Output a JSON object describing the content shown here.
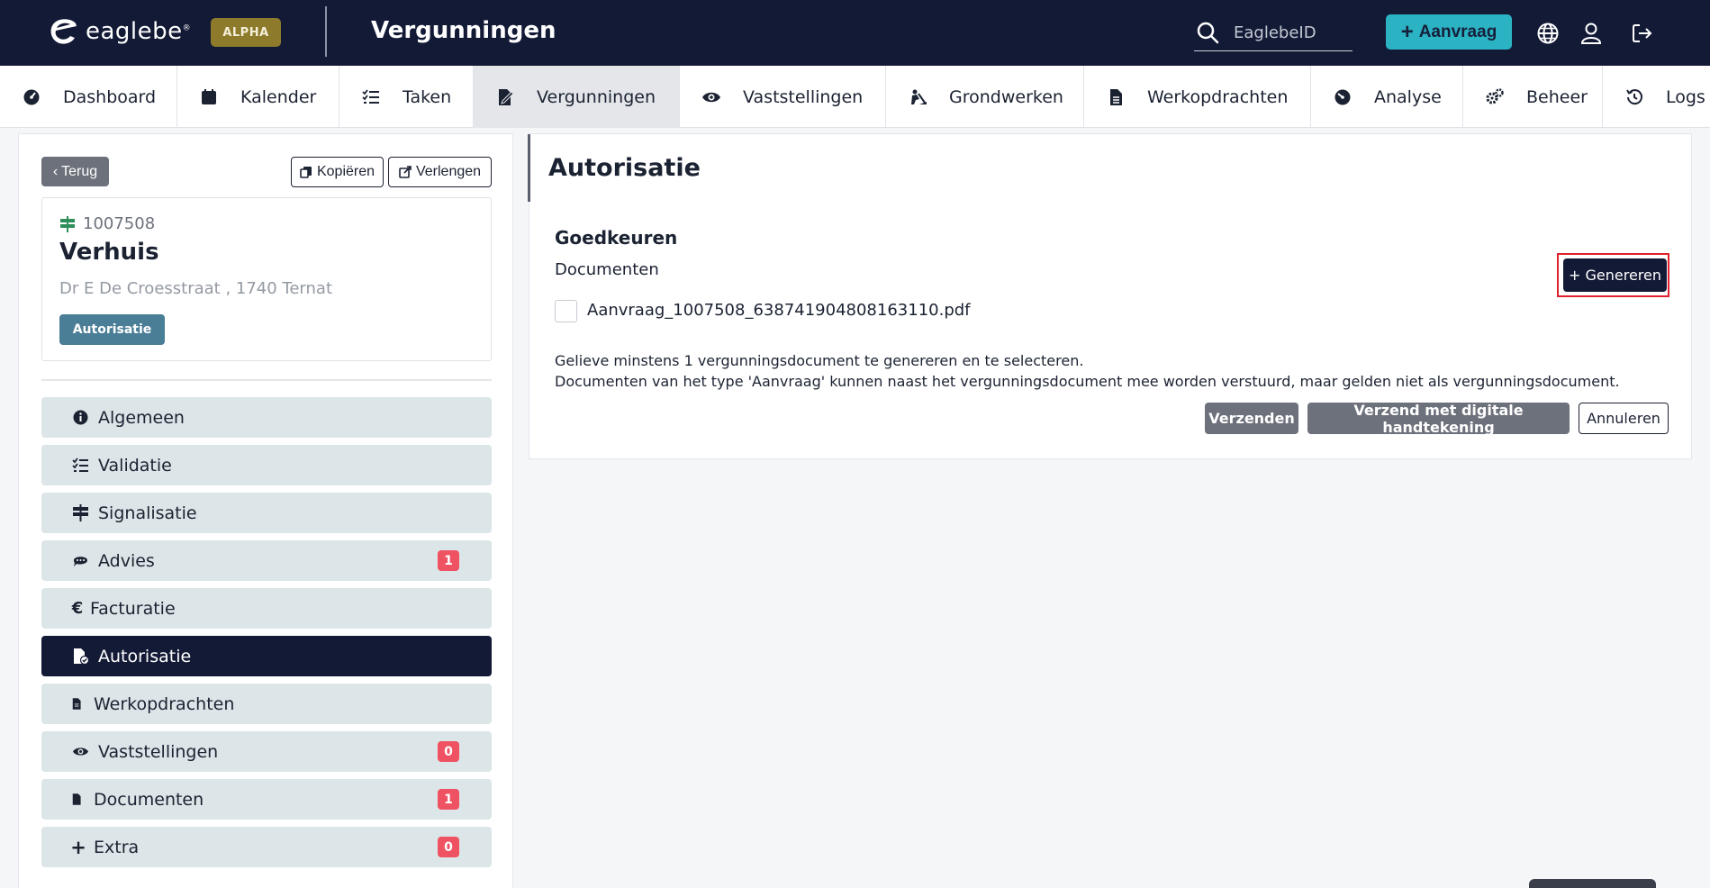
{
  "header": {
    "logo_text": "eaglebe",
    "logo_reg": "®",
    "env_badge": "ALPHA",
    "page_title": "Vergunningen",
    "search_placeholder": "EaglebeID",
    "new_request_label": "Aanvraag",
    "icons": [
      "globe-icon",
      "user-icon",
      "logout-icon"
    ],
    "colors": {
      "background": "#131a36",
      "alpha": "#8d7a2b",
      "accent": "#2bb3c4"
    }
  },
  "nav": {
    "items": [
      {
        "label": "Dashboard",
        "icon": "dashboard-icon"
      },
      {
        "label": "Kalender",
        "icon": "calendar-icon"
      },
      {
        "label": "Taken",
        "icon": "tasks-icon"
      },
      {
        "label": "Vergunningen",
        "icon": "permit-icon",
        "active": true
      },
      {
        "label": "Vaststellingen",
        "icon": "eye-icon"
      },
      {
        "label": "Grondwerken",
        "icon": "digging-icon"
      },
      {
        "label": "Werkopdrachten",
        "icon": "document-icon"
      },
      {
        "label": "Analyse",
        "icon": "gauge-icon"
      },
      {
        "label": "Beheer",
        "icon": "cogs-icon"
      },
      {
        "label": "Logs",
        "icon": "history-icon"
      }
    ]
  },
  "left": {
    "back_label": "Terug",
    "copy_label": "Kopiëren",
    "extend_label": "Verlengen",
    "card": {
      "id": "1007508",
      "title": "Verhuis",
      "address": "Dr E De Croesstraat , 1740 Ternat",
      "status": "Autorisatie"
    },
    "menu": [
      {
        "label": "Algemeen",
        "icon": "info-icon"
      },
      {
        "label": "Validatie",
        "icon": "checklist-icon"
      },
      {
        "label": "Signalisatie",
        "icon": "signpost-icon"
      },
      {
        "label": "Advies",
        "icon": "comments-icon",
        "count": "1"
      },
      {
        "label": "Facturatie",
        "icon": "euro-icon"
      },
      {
        "label": "Autorisatie",
        "icon": "file-check-icon",
        "active": true
      },
      {
        "label": "Werkopdrachten",
        "icon": "file-icon"
      },
      {
        "label": "Vaststellingen",
        "icon": "eye-icon",
        "count": "0"
      },
      {
        "label": "Documenten",
        "icon": "file-icon",
        "count": "1"
      },
      {
        "label": "Extra",
        "icon": "plus-icon",
        "count": "0"
      }
    ]
  },
  "main": {
    "title": "Autorisatie",
    "section_title": "Goedkeuren",
    "documents_label": "Documenten",
    "generate_label": "+ Genereren",
    "file_name": "Aanvraag_1007508_638741904808163110.pdf",
    "file_checked": false,
    "info_line1": "Gelieve minstens 1 vergunningsdocument te genereren en te selecteren.",
    "info_line2": "Documenten van het type 'Aanvraag' kunnen naast het vergunningsdocument mee worden verstuurd, maar gelden niet als vergunningsdocument.",
    "send_label": "Verzenden",
    "send_signed_label": "Verzend met digitale handtekening",
    "cancel_label": "Annuleren"
  }
}
